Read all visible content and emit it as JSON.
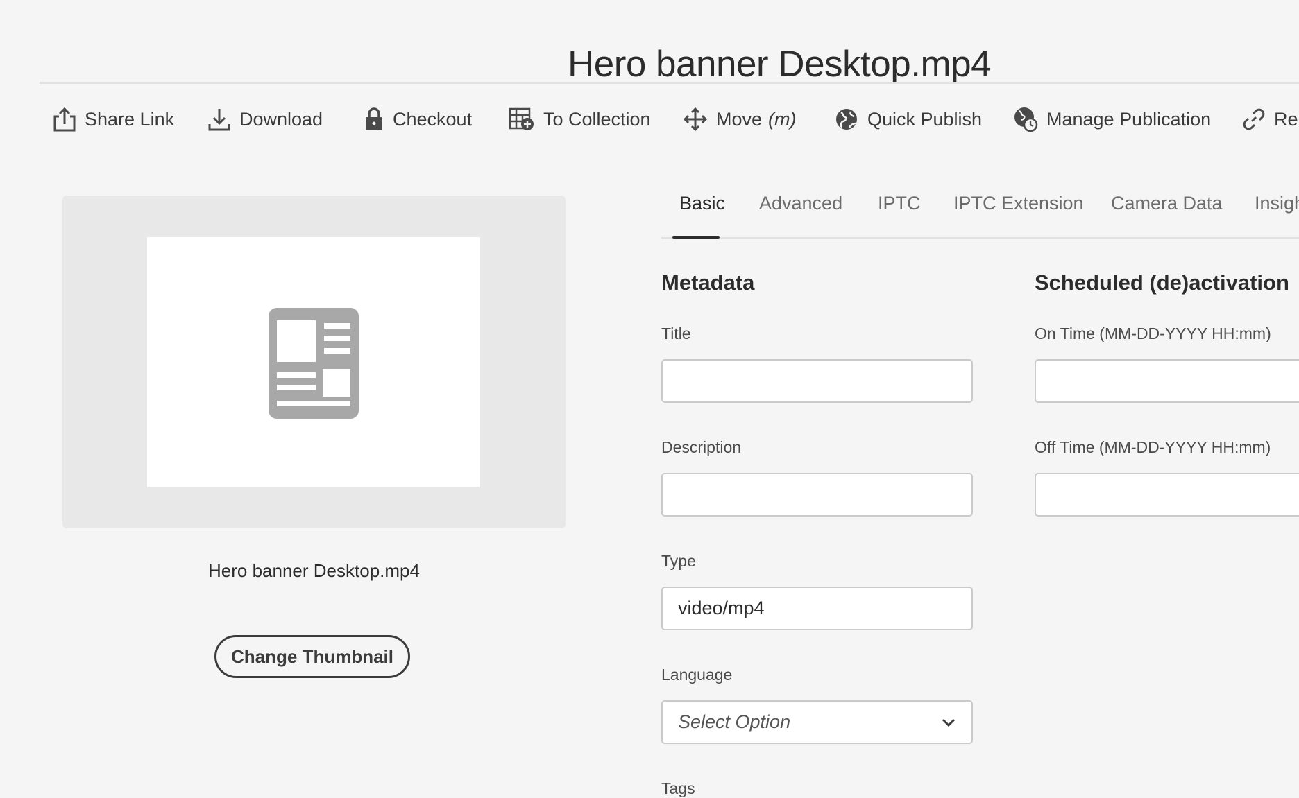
{
  "header": {
    "title": "Hero banner Desktop.mp4"
  },
  "toolbar": {
    "items": [
      {
        "label": "Share Link",
        "icon": "share-icon"
      },
      {
        "label": "Download",
        "icon": "download-icon"
      },
      {
        "label": "Checkout",
        "icon": "lock-icon"
      },
      {
        "label": "To Collection",
        "icon": "collection-add-icon"
      },
      {
        "label": "Move",
        "hint": "(m)",
        "icon": "move-icon"
      },
      {
        "label": "Quick Publish",
        "icon": "globe-icon"
      },
      {
        "label": "Manage Publication",
        "icon": "globe-clock-icon"
      },
      {
        "label": "Rel",
        "icon": "link-icon"
      }
    ]
  },
  "preview": {
    "file_name": "Hero banner Desktop.mp4",
    "change_thumbnail_label": "Change Thumbnail",
    "placeholder_icon": "document-layout-icon"
  },
  "tabs": [
    {
      "label": "Basic",
      "active": true
    },
    {
      "label": "Advanced",
      "active": false
    },
    {
      "label": "IPTC",
      "active": false
    },
    {
      "label": "IPTC Extension",
      "active": false
    },
    {
      "label": "Camera Data",
      "active": false
    },
    {
      "label": "Insigh",
      "active": false
    }
  ],
  "metadata": {
    "heading": "Metadata",
    "title": {
      "label": "Title",
      "value": ""
    },
    "description": {
      "label": "Description",
      "value": ""
    },
    "type": {
      "label": "Type",
      "value": "video/mp4"
    },
    "language": {
      "label": "Language",
      "placeholder": "Select Option"
    },
    "tags": {
      "label": "Tags"
    }
  },
  "schedule": {
    "heading": "Scheduled (de)activation",
    "on_time": {
      "label": "On Time (MM-DD-YYYY HH:mm)",
      "value": ""
    },
    "off_time": {
      "label": "Off Time (MM-DD-YYYY HH:mm)",
      "value": ""
    }
  }
}
